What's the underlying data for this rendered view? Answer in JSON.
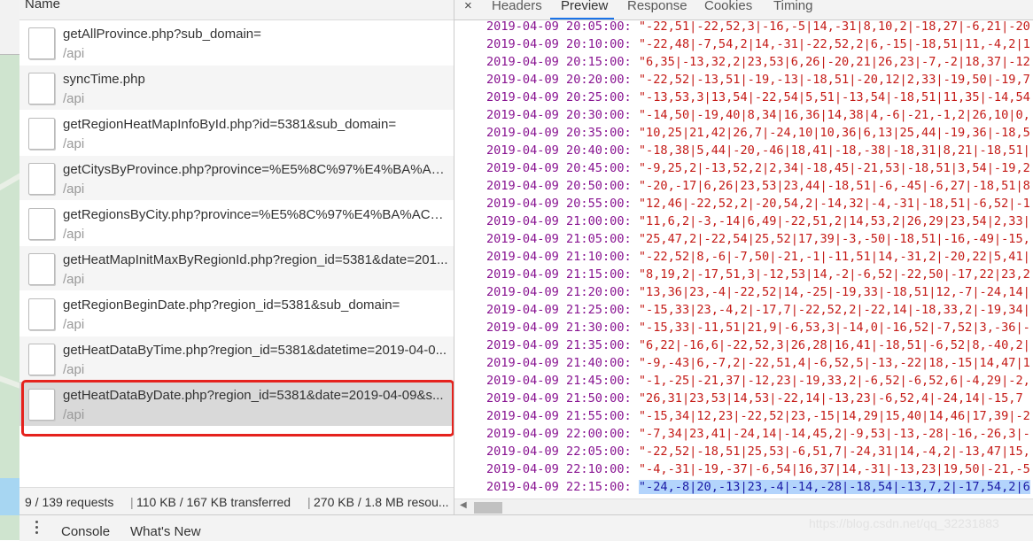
{
  "network": {
    "column_header": "Name",
    "requests": [
      {
        "name": "getAllProvince.php?sub_domain=",
        "path": "/api"
      },
      {
        "name": "syncTime.php",
        "path": "/api"
      },
      {
        "name": "getRegionHeatMapInfoById.php?id=5381&sub_domain=",
        "path": "/api"
      },
      {
        "name": "getCitysByProvince.php?province=%E5%8C%97%E4%BA%AC%E...",
        "path": "/api"
      },
      {
        "name": "getRegionsByCity.php?province=%E5%8C%97%E4%BA%AC%E....",
        "path": "/api"
      },
      {
        "name": "getHeatMapInitMaxByRegionId.php?region_id=5381&date=201...",
        "path": "/api"
      },
      {
        "name": "getRegionBeginDate.php?region_id=5381&sub_domain=",
        "path": "/api"
      },
      {
        "name": "getHeatDataByTime.php?region_id=5381&datetime=2019-04-0...",
        "path": "/api"
      },
      {
        "name": "getHeatDataByDate.php?region_id=5381&date=2019-04-09&s...",
        "path": "/api"
      }
    ],
    "status": {
      "requests": "9 / 139 requests",
      "transferred": "110 KB / 167 KB transferred",
      "resources": "270 KB / 1.8 MB resou..."
    }
  },
  "detail_tabs": {
    "close": "×",
    "headers": "Headers",
    "preview": "Preview",
    "response": "Response",
    "cookies": "Cookies",
    "timing": "Timing"
  },
  "preview_lines": [
    {
      "key": "2019-04-09 20:05:00:",
      "value": "\"-22,51|-22,52,3|-16,-5|14,-31|8,10,2|-18,27|-6,21|-20"
    },
    {
      "key": "2019-04-09 20:10:00:",
      "value": "\"-22,48|-7,54,2|14,-31|-22,52,2|6,-15|-18,51|11,-4,2|1"
    },
    {
      "key": "2019-04-09 20:15:00:",
      "value": "\"6,35|-13,32,2|23,53|6,26|-20,21|26,23|-7,-2|18,37|-12"
    },
    {
      "key": "2019-04-09 20:20:00:",
      "value": "\"-22,52|-13,51|-19,-13|-18,51|-20,12|2,33|-19,50|-19,7"
    },
    {
      "key": "2019-04-09 20:25:00:",
      "value": "\"-13,53,3|13,54|-22,54|5,51|-13,54|-18,51|11,35|-14,54"
    },
    {
      "key": "2019-04-09 20:30:00:",
      "value": "\"-14,50|-19,40|8,34|16,36|14,38|4,-6|-21,-1,2|26,10|0,"
    },
    {
      "key": "2019-04-09 20:35:00:",
      "value": "\"10,25|21,42|26,7|-24,10|10,36|6,13|25,44|-19,36|-18,5"
    },
    {
      "key": "2019-04-09 20:40:00:",
      "value": "\"-18,38|5,44|-20,-46|18,41|-18,-38|-18,31|8,21|-18,51|"
    },
    {
      "key": "2019-04-09 20:45:00:",
      "value": "\"-9,25,2|-13,52,2|2,34|-18,45|-21,53|-18,51|3,54|-19,2"
    },
    {
      "key": "2019-04-09 20:50:00:",
      "value": "\"-20,-17|6,26|23,53|23,44|-18,51|-6,-45|-6,27|-18,51|8"
    },
    {
      "key": "2019-04-09 20:55:00:",
      "value": "\"12,46|-22,52,2|-20,54,2|-14,32|-4,-31|-18,51|-6,52|-1"
    },
    {
      "key": "2019-04-09 21:00:00:",
      "value": "\"11,6,2|-3,-14|6,49|-22,51,2|14,53,2|26,29|23,54|2,33|"
    },
    {
      "key": "2019-04-09 21:05:00:",
      "value": "\"25,47,2|-22,54|25,52|17,39|-3,-50|-18,51|-16,-49|-15,"
    },
    {
      "key": "2019-04-09 21:10:00:",
      "value": "\"-22,52|8,-6|-7,50|-21,-1|-11,51|14,-31,2|-20,22|5,41|"
    },
    {
      "key": "2019-04-09 21:15:00:",
      "value": "\"8,19,2|-17,51,3|-12,53|14,-2|-6,52|-22,50|-17,22|23,2"
    },
    {
      "key": "2019-04-09 21:20:00:",
      "value": "\"13,36|23,-4|-22,52|14,-25|-19,33|-18,51|12,-7|-24,14|"
    },
    {
      "key": "2019-04-09 21:25:00:",
      "value": "\"-15,33|23,-4,2|-17,7|-22,52,2|-22,14|-18,33,2|-19,34|"
    },
    {
      "key": "2019-04-09 21:30:00:",
      "value": "\"-15,33|-11,51|21,9|-6,53,3|-14,0|-16,52|-7,52|3,-36|-"
    },
    {
      "key": "2019-04-09 21:35:00:",
      "value": "\"6,22|-16,6|-22,52,3|26,28|16,41|-18,51|-6,52|8,-40,2|"
    },
    {
      "key": "2019-04-09 21:40:00:",
      "value": "\"-9,-43|6,-7,2|-22,51,4|-6,52,5|-13,-22|18,-15|14,47|1"
    },
    {
      "key": "2019-04-09 21:45:00:",
      "value": "\"-1,-25|-21,37|-12,23|-19,33,2|-6,52|-6,52,6|-4,29|-2,"
    },
    {
      "key": "2019-04-09 21:50:00:",
      "value": "\"26,31|23,53|14,53|-22,14|-13,23|-6,52,4|-24,14|-15,7"
    },
    {
      "key": "2019-04-09 21:55:00:",
      "value": "\"-15,34|12,23|-22,52|23,-15|14,29|15,40|14,46|17,39|-2"
    },
    {
      "key": "2019-04-09 22:00:00:",
      "value": "\"-7,34|23,41|-24,14|-14,45,2|-9,53|-13,-28|-16,-26,3|-"
    },
    {
      "key": "2019-04-09 22:05:00:",
      "value": "\"-22,52|-18,51|25,53|-6,51,7|-24,31|14,-4,2|-13,47|15,"
    },
    {
      "key": "2019-04-09 22:10:00:",
      "value": "\"-4,-31|-19,-37|-6,54|16,37|14,-31|-13,23|19,50|-21,-5"
    },
    {
      "key": "2019-04-09 22:15:00:",
      "value": "\"-24,-8|20,-13|23,-4|-14,-28|-18,54|-13,7,2|-17,54,2|6"
    }
  ],
  "drawer": {
    "console": "Console",
    "whats_new": "What's New"
  },
  "watermark": "https://blog.csdn.net/qq_32231883",
  "colors": {
    "selection_outline": "#e5221d",
    "active_tab_underline": "#1a73e8",
    "json_key": "#881391",
    "json_string": "#c41a16"
  }
}
